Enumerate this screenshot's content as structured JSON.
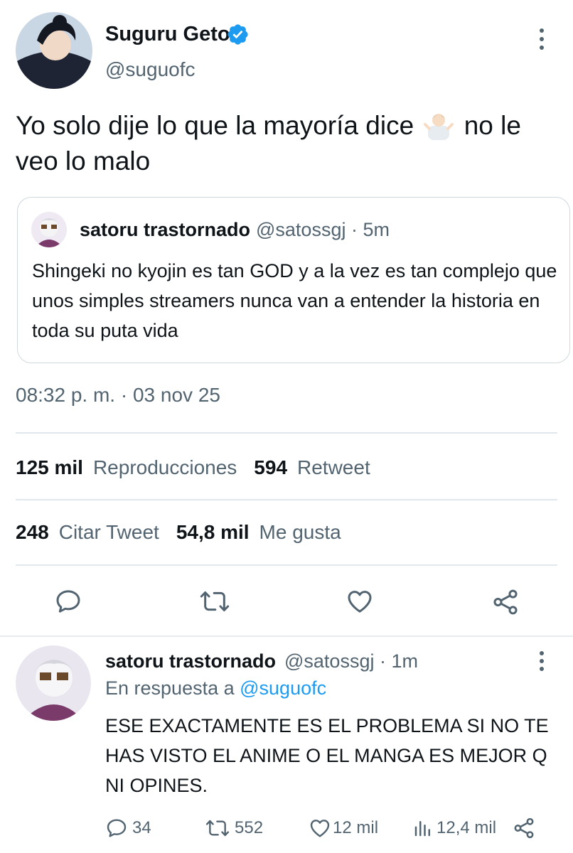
{
  "tweet": {
    "display_name": "Suguru Geto.",
    "handle": "@suguofc",
    "text_before_emoji": "Yo solo dije lo que la mayoría dice",
    "text_after_emoji": " no le veo lo malo",
    "emoji": "person-shrugging",
    "timestamp": "08:32 p. m. · 03 nov 25",
    "stats": {
      "views_count": "125 mil",
      "views_label": "Reproducciones",
      "retweets_count": "594",
      "retweets_label": "Retweet",
      "quotes_count": "248",
      "quotes_label": "Citar Tweet",
      "likes_count": "54,8 mil",
      "likes_label": "Me gusta"
    },
    "actions": [
      "reply-icon",
      "retweet-icon",
      "like-icon",
      "share-icon"
    ]
  },
  "quote": {
    "display_name": "satoru trastornado",
    "handle_time": "@satossgj · 5m",
    "text": "Shingeki no kyojin es tan GOD y a la vez es tan complejo que unos simples streamers nunca van a entender la historia en toda su puta vida"
  },
  "reply": {
    "display_name": "satoru trastornado",
    "handle_time": "@satossgj · 1m",
    "reply_prefix": "En respuesta a ",
    "reply_to": "@suguofc",
    "text": "ESE EXACTAMENTE ES EL PROBLEMA SI NO TE HAS VISTO EL ANIME O EL MANGA ES MEJOR Q NI OPINES.",
    "replies": "34",
    "retweets": "552",
    "likes": "12 mil",
    "views": "12,4 mil"
  },
  "colors": {
    "primary_text": "#0f1419",
    "secondary_text": "#536471",
    "link": "#1d9bf0",
    "divider": "#e1e8ed"
  }
}
